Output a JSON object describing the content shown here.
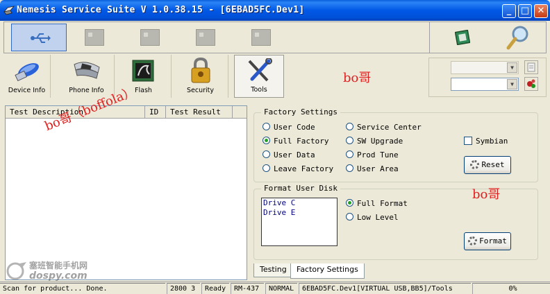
{
  "window": {
    "title": "Nemesis Service Suite V 1.0.38.15 - [6EBAD5FC.Dev1]",
    "minimize": "_",
    "maximize": "□",
    "close": "✕"
  },
  "top_buttons": [
    {
      "icon": "usb-icon",
      "active": true
    },
    {
      "icon": "device-slot-icon"
    },
    {
      "icon": "device-slot-icon"
    },
    {
      "icon": "device-slot-icon"
    },
    {
      "icon": "device-slot-icon"
    }
  ],
  "top_right_icons": [
    "chip-icon",
    "magnifier-icon"
  ],
  "toolbar": {
    "device_info": "Device Info",
    "phone_info": "Phone Info",
    "flash": "Flash",
    "security": "Security",
    "tools": "Tools"
  },
  "table": {
    "columns": [
      "Test Description",
      "ID",
      "Test Result"
    ]
  },
  "factory_settings": {
    "title": "Factory Settings",
    "options": [
      {
        "label": "User Code",
        "selected": false
      },
      {
        "label": "Service Center",
        "selected": false
      },
      {
        "label": "Full Factory",
        "selected": true
      },
      {
        "label": "SW Upgrade",
        "selected": false
      },
      {
        "label": "User Data",
        "selected": false
      },
      {
        "label": "Prod Tune",
        "selected": false
      },
      {
        "label": "Leave Factory",
        "selected": false
      },
      {
        "label": "User Area",
        "selected": false
      }
    ],
    "symbian_label": "Symbian",
    "symbian_checked": false,
    "reset_label": "Reset"
  },
  "format_disk": {
    "title": "Format User Disk",
    "drives": [
      "Drive C",
      "Drive E"
    ],
    "full_format": "Full Format",
    "low_level": "Low Level",
    "format_label": "Format"
  },
  "tabs": [
    "Testing",
    "Factory Settings"
  ],
  "status": {
    "message": "Scan for product... Done.",
    "code": "2800 3",
    "state": "Ready",
    "model": "RM-437",
    "mode": "NORMAL",
    "path": "6EBAD5FC.Dev1[VIRTUAL USB,BB5]/Tools",
    "progress": "0%"
  },
  "watermarks": {
    "wm1": "bo哥",
    "wm2": "bo哥（boffola）",
    "wm3": "bo哥",
    "site_name": "塞班智能手机网",
    "site_domain": "dospy.com"
  },
  "colors": {
    "title_blue": "#0058E6",
    "watermark_red": "#E02020",
    "radio_green": "#21A121"
  }
}
